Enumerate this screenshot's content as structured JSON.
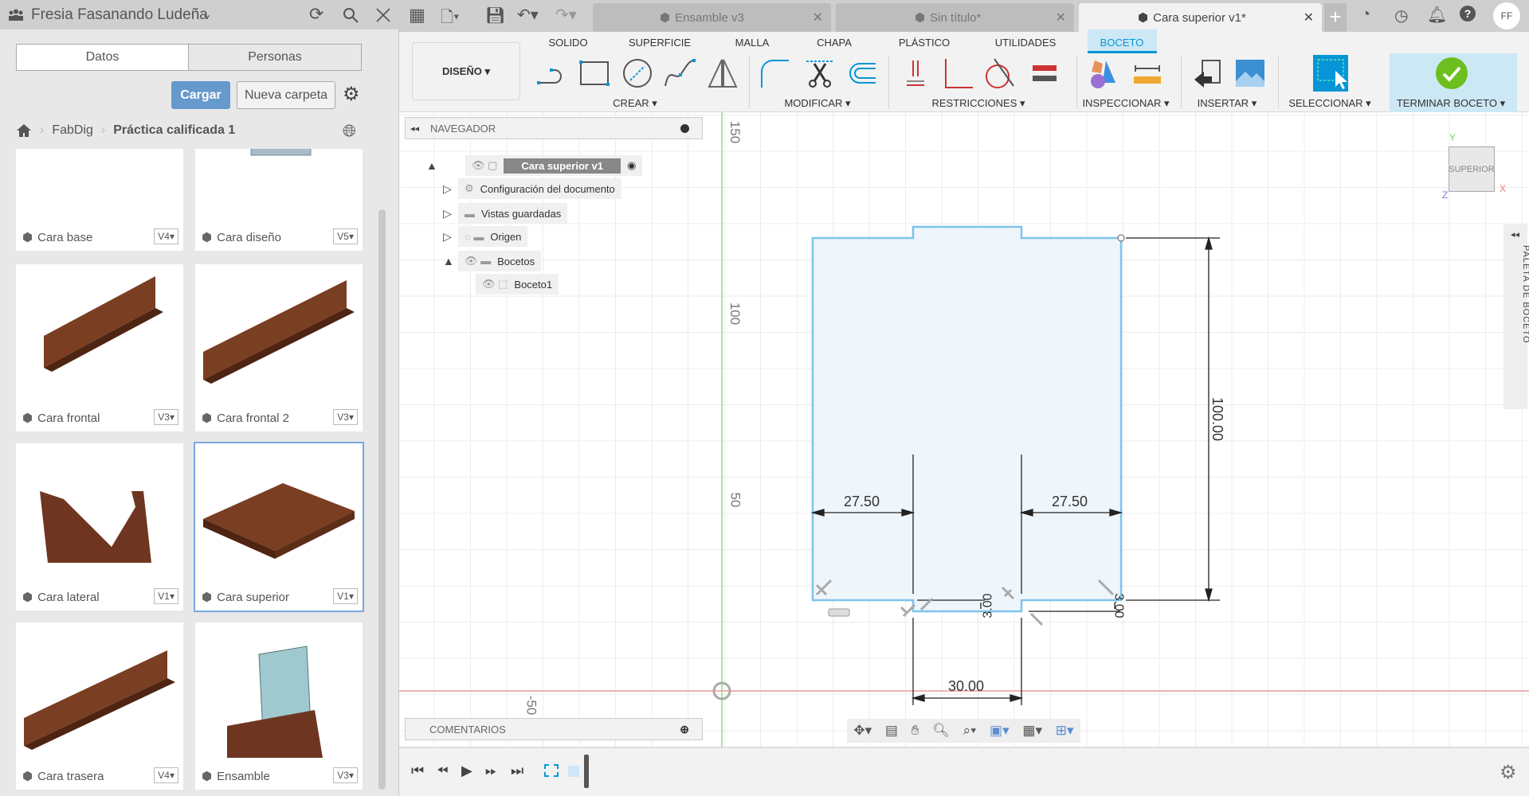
{
  "data_panel": {
    "user": "Fresia Fasanando Ludeña",
    "tabs": [
      "Datos",
      "Personas"
    ],
    "upload_label": "Cargar",
    "new_folder_label": "Nueva carpeta",
    "breadcrumb": [
      "FabDig",
      "Práctica calificada 1"
    ],
    "items": [
      {
        "name": "Cara base",
        "version": "V4"
      },
      {
        "name": "Cara diseño",
        "version": "V5"
      },
      {
        "name": "Cara frontal",
        "version": "V3"
      },
      {
        "name": "Cara frontal 2",
        "version": "V3"
      },
      {
        "name": "Cara lateral",
        "version": "V1"
      },
      {
        "name": "Cara superior",
        "version": "V1",
        "selected": true
      },
      {
        "name": "Cara trasera",
        "version": "V4"
      },
      {
        "name": "Ensamble",
        "version": "V3"
      }
    ]
  },
  "doc_tabs": [
    {
      "label": "Ensamble v3",
      "active": false
    },
    {
      "label": "Sin título*",
      "active": false
    },
    {
      "label": "Cara superior v1*",
      "active": true
    }
  ],
  "avatar": "FF",
  "toolbar": {
    "workspace": "DISEÑO",
    "tabs": [
      "SOLIDO",
      "SUPERFICIE",
      "MALLA",
      "CHAPA",
      "PLÁSTICO",
      "UTILIDADES",
      "BOCETO"
    ],
    "active_tab": "BOCETO",
    "groups": [
      "CREAR",
      "MODIFICAR",
      "RESTRICCIONES",
      "INSPECCIONAR",
      "INSERTAR",
      "SELECCIONAR",
      "TERMINAR BOCETO"
    ],
    "accent": "#0696d7",
    "finish_color": "#6cbf1e"
  },
  "navigator": {
    "title": "NAVEGADOR",
    "nodes": [
      {
        "label": "Cara superior v1"
      },
      {
        "label": "Configuración del documento"
      },
      {
        "label": "Vistas guardadas"
      },
      {
        "label": "Origen"
      },
      {
        "label": "Bocetos"
      },
      {
        "label": "Boceto1"
      }
    ]
  },
  "comments_label": "COMENTARIOS",
  "viewcube_label": "SUPERIOR",
  "axes": {
    "x": "X",
    "y": "Y",
    "z": "Z"
  },
  "sketch_palette_label": "PALETA DE BOCETO",
  "ruler_labels": [
    "150",
    "100",
    "50",
    "-50"
  ],
  "dimensions": {
    "left_width": "27.50",
    "right_width": "27.50",
    "height": "100.00",
    "notch_width": "30.00",
    "notch_depth_left": "3.00",
    "notch_depth_right": "3.00"
  }
}
